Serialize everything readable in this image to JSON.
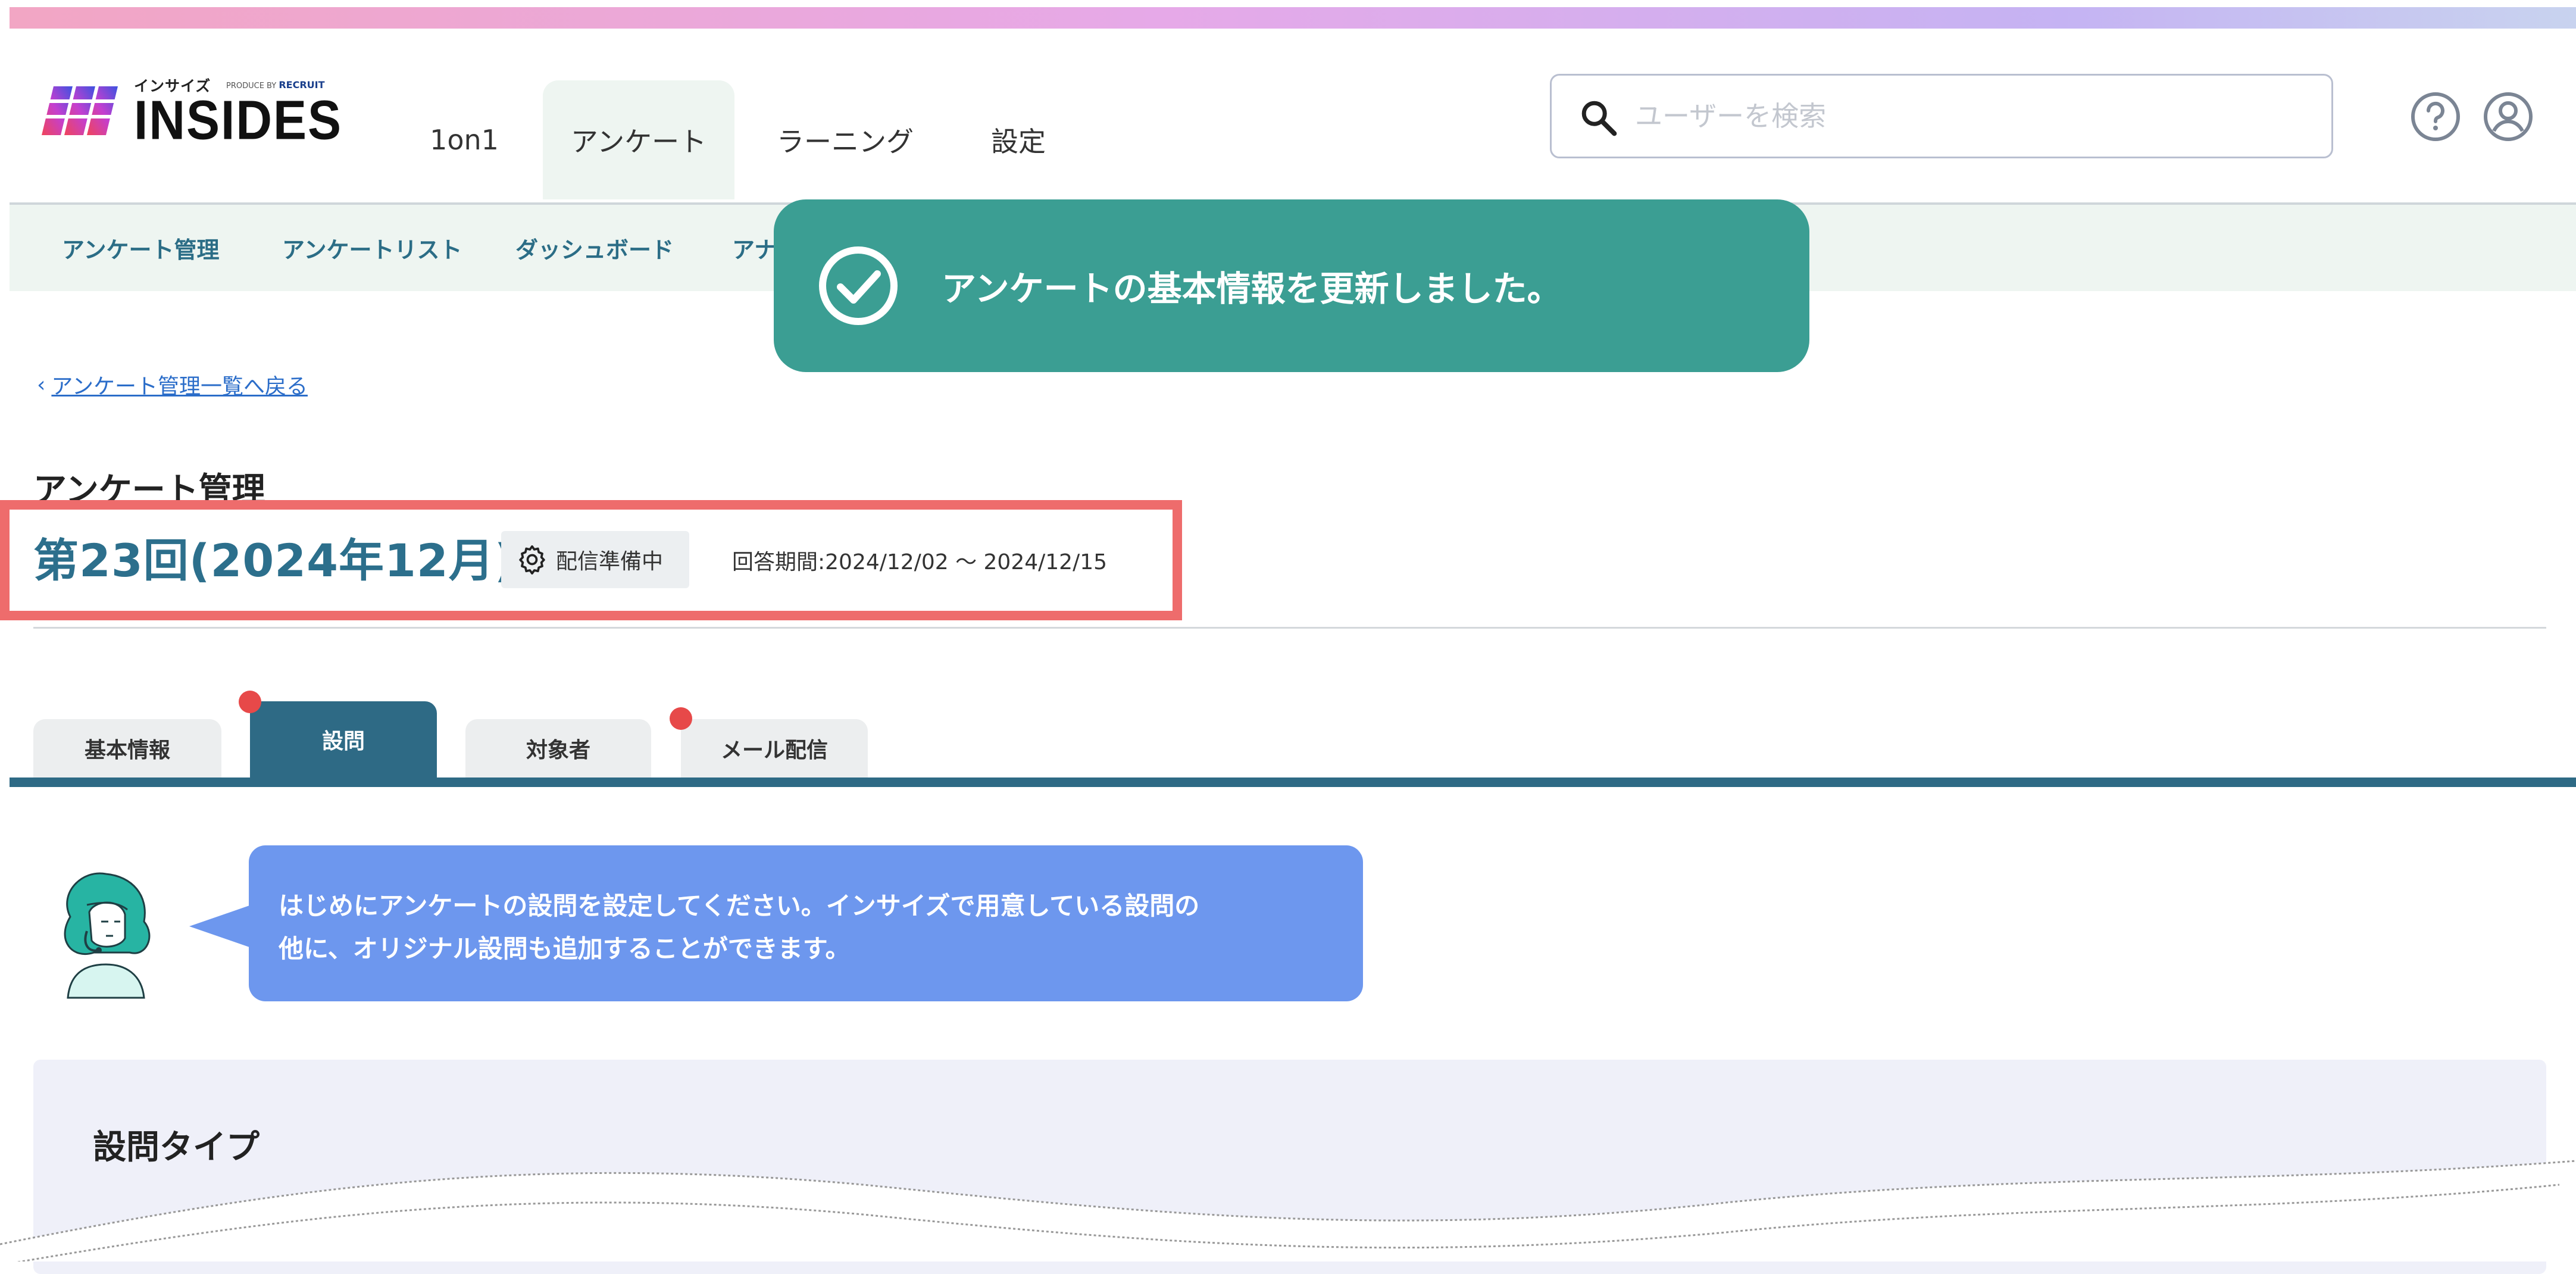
{
  "app": {
    "logo_kana": "インサイズ",
    "logo_produced_by": "PRODUCE BY",
    "logo_recruit": "RECRUIT",
    "logo_name": "INSIDES"
  },
  "header": {
    "nav": [
      {
        "label": "1on1",
        "active": false
      },
      {
        "label": "アンケート",
        "active": true
      },
      {
        "label": "ラーニング",
        "active": false
      },
      {
        "label": "設定",
        "active": false
      }
    ],
    "search": {
      "placeholder": "ユーザーを検索",
      "value": ""
    },
    "icons": [
      "search-icon",
      "help-icon",
      "user-account-icon"
    ]
  },
  "subnav": {
    "items": [
      "アンケート管理",
      "アンケートリスト",
      "ダッシュボード",
      "アナ"
    ]
  },
  "toast": {
    "icon": "check-circle-icon",
    "message": "アンケートの基本情報を更新しました。",
    "color": "#3b9e93"
  },
  "back_link": {
    "arrow": "‹",
    "label": "アンケート管理一覧へ戻る"
  },
  "page": {
    "title": "アンケート管理",
    "survey_name": "第23回(2024年12月)",
    "status": {
      "icon": "gear-icon",
      "label": "配信準備中"
    },
    "period": "回答期間:2024/12/02 〜 2024/12/15"
  },
  "tabs": [
    {
      "label": "基本情報",
      "active": false,
      "dot": false
    },
    {
      "label": "設問",
      "active": true,
      "dot": true
    },
    {
      "label": "対象者",
      "active": false,
      "dot": false
    },
    {
      "label": "メール配信",
      "active": false,
      "dot": true
    }
  ],
  "assistant": {
    "avatar_icon": "support-operator-avatar",
    "message_line1": "はじめにアンケートの設問を設定してください。インサイズで用意している設問の",
    "message_line2": "他に、オリジナル設問も追加することができます。"
  },
  "panel": {
    "title": "設問タイプ"
  },
  "colors": {
    "accent": "#2e6a85",
    "link": "#2b6dc9",
    "highlight_border": "#ee6c6c",
    "notification_dot": "#e74949",
    "bubble": "#6d97ee"
  }
}
